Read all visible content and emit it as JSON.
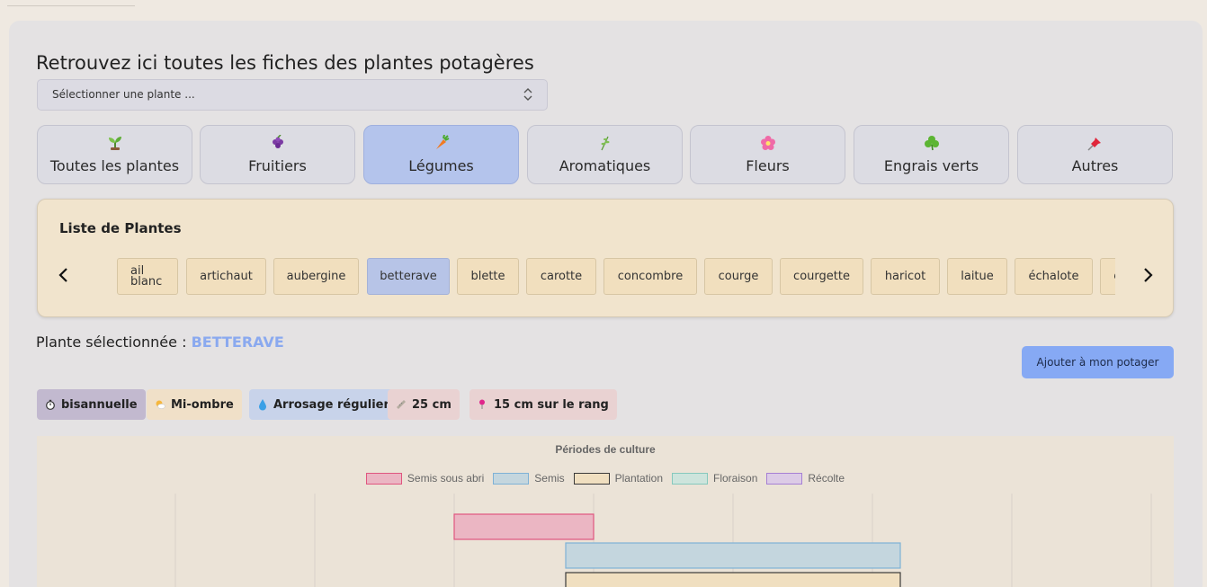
{
  "header": {
    "title": "Retrouvez ici toutes les fiches des plantes potagères"
  },
  "select": {
    "placeholder": "Sélectionner une plante ..."
  },
  "categories": [
    {
      "label": "Toutes les plantes",
      "icon": "seedling-icon",
      "active": false
    },
    {
      "label": "Fruitiers",
      "icon": "grapes-icon",
      "active": false
    },
    {
      "label": "Légumes",
      "icon": "carrot-icon",
      "active": true
    },
    {
      "label": "Aromatiques",
      "icon": "herb-icon",
      "active": false
    },
    {
      "label": "Fleurs",
      "icon": "flower-icon",
      "active": false
    },
    {
      "label": "Engrais verts",
      "icon": "shamrock-icon",
      "active": false
    },
    {
      "label": "Autres",
      "icon": "pushpin-icon",
      "active": false
    }
  ],
  "plant_list": {
    "title": "Liste de Plantes",
    "items": [
      "ail blanc",
      "artichaut",
      "aubergine",
      "betterave",
      "blette",
      "carotte",
      "concombre",
      "courge",
      "courgette",
      "haricot",
      "laitue",
      "échalote",
      "épinard"
    ],
    "selected": "betterave"
  },
  "selection": {
    "label": "Plante sélectionnée :",
    "value": "BETTERAVE"
  },
  "add_button": {
    "label": "Ajouter à mon potager"
  },
  "badges": [
    {
      "label": "bisannuelle",
      "icon": "stopwatch-icon",
      "color": "#c2b9cf"
    },
    {
      "label": "Mi-ombre",
      "icon": "sun-cloud-icon",
      "color": "#f0e0c8"
    },
    {
      "label": "Arrosage régulier",
      "icon": "droplet-icon",
      "color": "#c8d3ea"
    },
    {
      "label": "25 cm",
      "icon": "ruler-icon",
      "color": "#e9d2d2"
    },
    {
      "label": "15 cm sur le rang",
      "icon": "pin-icon",
      "color": "#e9d2d2"
    }
  ],
  "chart_data": {
    "type": "bar",
    "title": "Périodes de culture",
    "legend_position": "top",
    "series": [
      {
        "name": "Semis sous abri",
        "fill": "#ebb6c3",
        "stroke": "#e0567f",
        "start": 3,
        "end": 4
      },
      {
        "name": "Semis",
        "fill": "#c4d6de",
        "stroke": "#7fb2d6",
        "start": 3.8,
        "end": 6.2
      },
      {
        "name": "Plantation",
        "fill": "#f0dfc0",
        "stroke": "#3a3a3a",
        "start": 3.8,
        "end": 6.2
      },
      {
        "name": "Floraison",
        "fill": "#cde4dc",
        "stroke": "#86c9bd",
        "start": null,
        "end": null
      },
      {
        "name": "Récolte",
        "fill": "#dccbe6",
        "stroke": "#a680d4",
        "start": null,
        "end": null
      }
    ],
    "grid": true,
    "xlim": [
      0,
      7.9
    ]
  }
}
